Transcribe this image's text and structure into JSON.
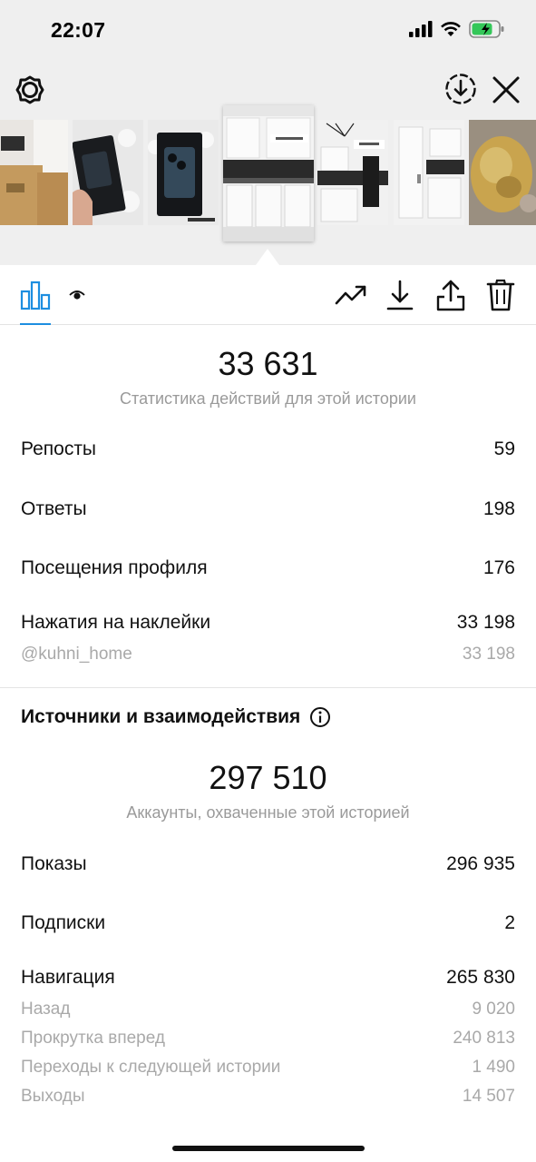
{
  "status_bar": {
    "time": "22:07"
  },
  "header": {
    "settings_icon": "gear-icon",
    "download_icon": "download-circle-icon",
    "close_icon": "close-icon"
  },
  "thumbnails": [
    {
      "name": "thumb-1",
      "kind": "boxes"
    },
    {
      "name": "thumb-2",
      "kind": "phone-box"
    },
    {
      "name": "thumb-3",
      "kind": "phone-box"
    },
    {
      "name": "thumb-4",
      "kind": "kitchen",
      "selected": true,
      "overlay_text": "@kuhni_home"
    },
    {
      "name": "thumb-5",
      "kind": "kitchen",
      "overlay_text": "@kuhni_home"
    },
    {
      "name": "thumb-6",
      "kind": "kitchen"
    },
    {
      "name": "thumb-7",
      "kind": "food"
    }
  ],
  "tabs": {
    "stats_icon": "bar-chart-icon",
    "viewers_icon": "eye-icon",
    "actions": [
      "trending-icon",
      "download-icon",
      "share-icon",
      "trash-icon"
    ]
  },
  "interactions": {
    "total": "33 631",
    "caption": "Статистика действий для этой истории",
    "rows": [
      {
        "label": "Репосты",
        "value": "59"
      },
      {
        "label": "Ответы",
        "value": "198"
      },
      {
        "label": "Посещения профиля",
        "value": "176"
      },
      {
        "label": "Нажатия на наклейки",
        "value": "33 198"
      }
    ],
    "sticker_row": {
      "label": "@kuhni_home",
      "value": "33 198"
    }
  },
  "discovery": {
    "title": "Источники и взаимодействия",
    "info_icon": "info-icon",
    "total": "297 510",
    "caption": "Аккаунты, охваченные этой историей",
    "rows": [
      {
        "label": "Показы",
        "value": "296 935"
      },
      {
        "label": "Подписки",
        "value": "2"
      },
      {
        "label": "Навигация",
        "value": "265 830"
      }
    ],
    "navigation_rows": [
      {
        "label": "Назад",
        "value": "9 020"
      },
      {
        "label": "Прокрутка вперед",
        "value": "240 813"
      },
      {
        "label": "Переходы к следующей истории",
        "value": "1 490"
      },
      {
        "label": "Выходы",
        "value": "14 507"
      }
    ]
  },
  "colors": {
    "accent": "#1d8ee0",
    "muted_text": "#9a9a9a",
    "battery_green": "#34c759"
  }
}
